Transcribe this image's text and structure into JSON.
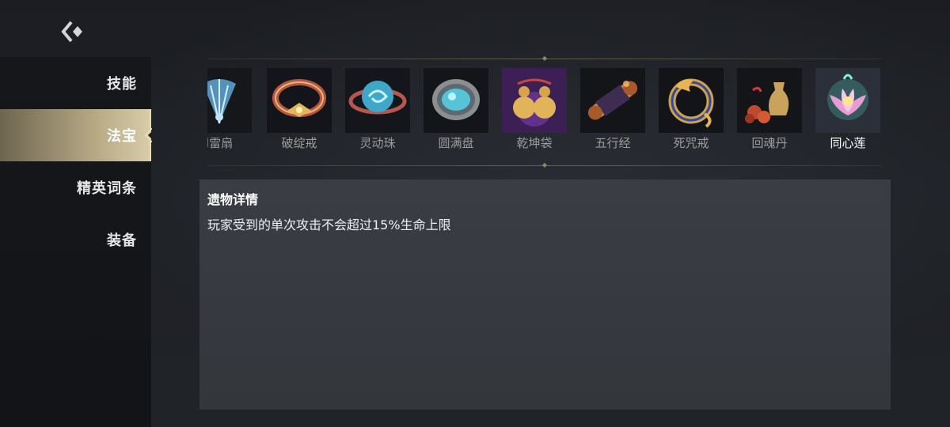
{
  "nav": {
    "back_icon": "back-chevron-icon"
  },
  "sidebar": {
    "items": [
      {
        "label": "技能",
        "active": false
      },
      {
        "label": "法宝",
        "active": true
      },
      {
        "label": "精英词条",
        "active": false
      },
      {
        "label": "装备",
        "active": false
      }
    ]
  },
  "relics": {
    "items": [
      {
        "name": "风雷扇",
        "icon": "ice-fan-icon",
        "visible_name": "l雷扇"
      },
      {
        "name": "破绽戒",
        "icon": "golden-ring-icon"
      },
      {
        "name": "灵动珠",
        "icon": "spirit-orb-icon"
      },
      {
        "name": "圆满盘",
        "icon": "jade-disc-icon"
      },
      {
        "name": "乾坤袋",
        "icon": "gourd-pouch-icon"
      },
      {
        "name": "五行经",
        "icon": "scroll-icon"
      },
      {
        "name": "死咒戒",
        "icon": "cursed-ring-icon"
      },
      {
        "name": "回魂丹",
        "icon": "elixir-jar-icon"
      },
      {
        "name": "同心莲",
        "icon": "lotus-icon",
        "selected": true
      }
    ]
  },
  "details": {
    "title": "遗物详情",
    "description": "玩家受到的单次攻击不会超过15%生命上限"
  },
  "colors": {
    "accent_gold": "#c9bb92",
    "panel_bg": "#383b41",
    "background": "#1e2025"
  }
}
